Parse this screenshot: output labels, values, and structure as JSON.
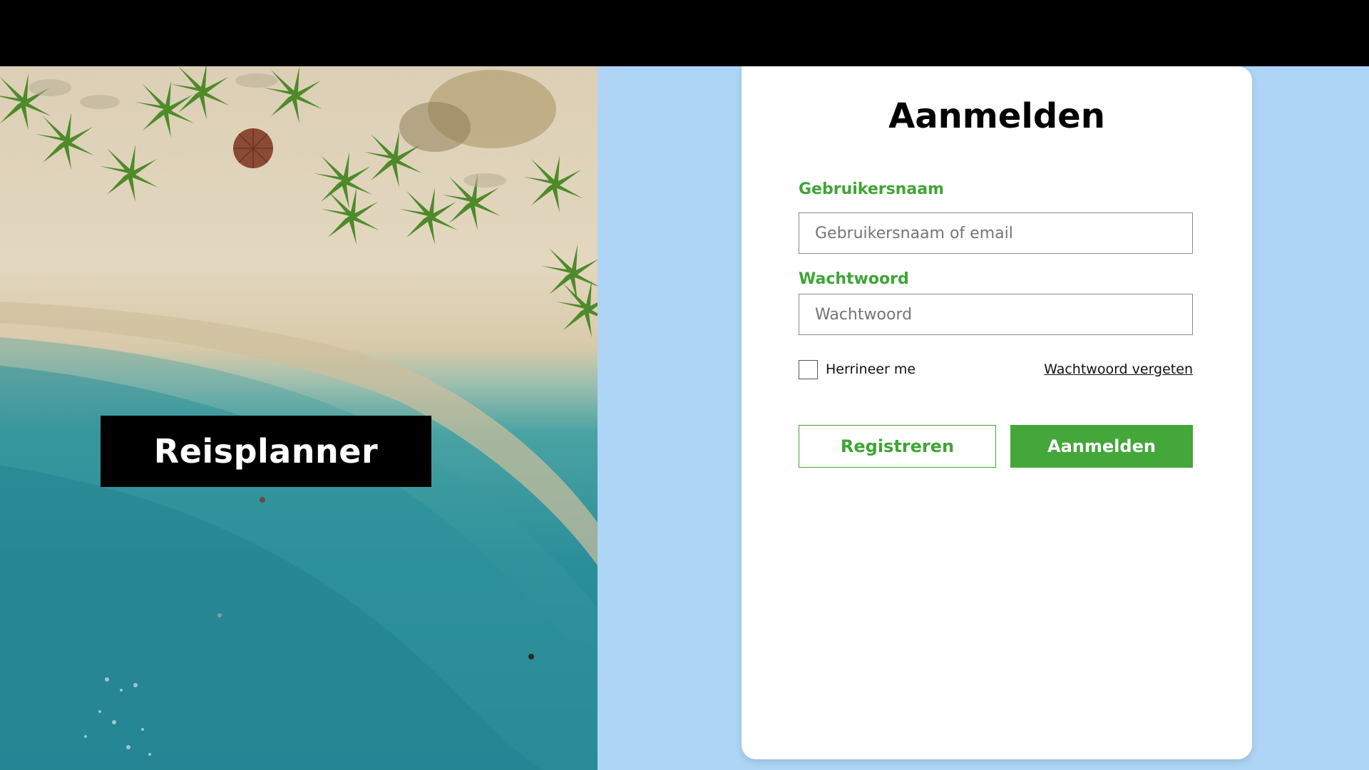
{
  "brand": {
    "name": "Reisplanner"
  },
  "login": {
    "title": "Aanmelden",
    "username_label": "Gebruikersnaam",
    "username_placeholder": "Gebruikersnaam of email",
    "password_label": "Wachtwoord",
    "password_placeholder": "Wachtwoord",
    "remember_label": "Herrineer me",
    "remember_checked": false,
    "forgot_link": "Wachtwoord vergeten",
    "register_button": "Registreren",
    "login_button": "Aanmelden"
  },
  "colors": {
    "accent": "#3fa535",
    "right_background": "#aed5f6",
    "topbar": "#000000"
  }
}
